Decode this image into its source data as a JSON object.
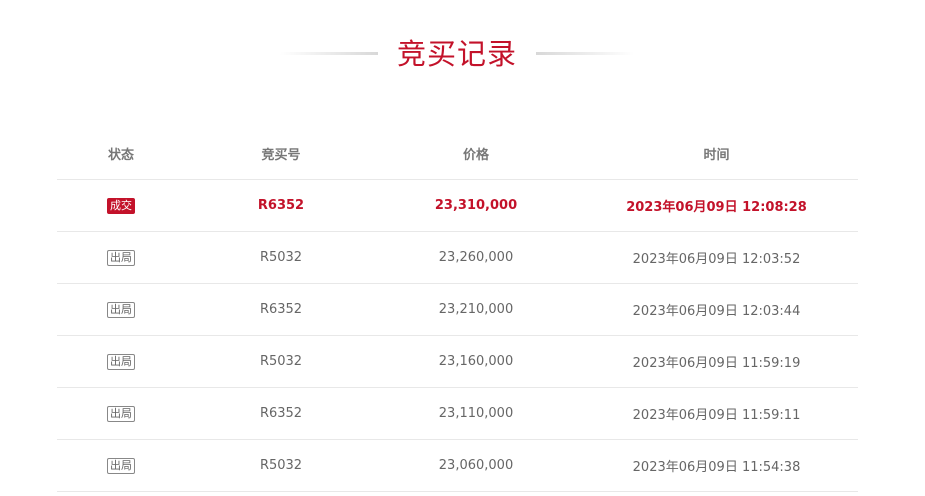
{
  "page": {
    "title": "竞买记录",
    "accent_color": "#c3122a"
  },
  "table": {
    "headers": {
      "status": "状态",
      "bid_no": "竞买号",
      "price": "价格",
      "time": "时间"
    },
    "rows": [
      {
        "status": "成交",
        "bid_no": "R6352",
        "price": "23,310,000",
        "time": "2023年06月09日 12:08:28"
      },
      {
        "status": "出局",
        "bid_no": "R5032",
        "price": "23,260,000",
        "time": "2023年06月09日 12:03:52"
      },
      {
        "status": "出局",
        "bid_no": "R6352",
        "price": "23,210,000",
        "time": "2023年06月09日 12:03:44"
      },
      {
        "status": "出局",
        "bid_no": "R5032",
        "price": "23,160,000",
        "time": "2023年06月09日 11:59:19"
      },
      {
        "status": "出局",
        "bid_no": "R6352",
        "price": "23,110,000",
        "time": "2023年06月09日 11:59:11"
      },
      {
        "status": "出局",
        "bid_no": "R5032",
        "price": "23,060,000",
        "time": "2023年06月09日 11:54:38"
      }
    ]
  }
}
